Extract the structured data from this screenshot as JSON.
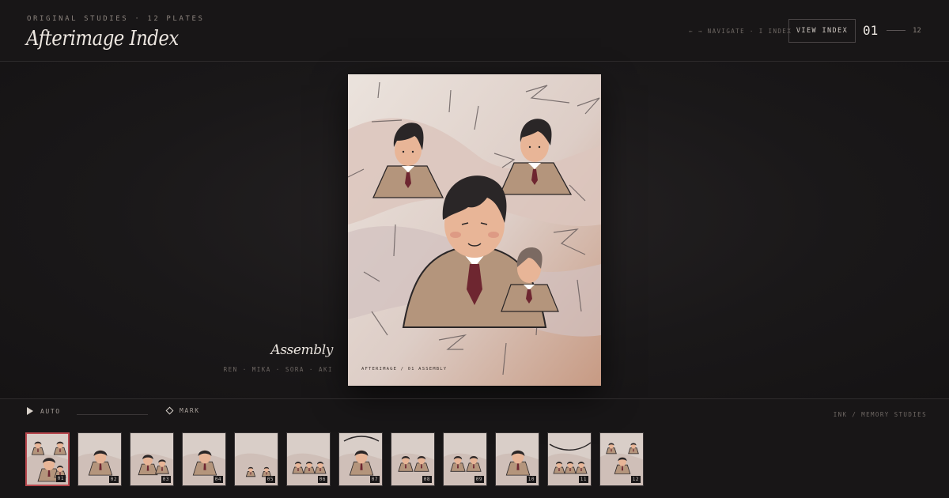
{
  "header": {
    "eyebrow": "ORIGINAL STUDIES · 12 PLATES",
    "title": "Afterimage Index",
    "nav_hint": "← → NAVIGATE · I INDEX",
    "view_index_label": "VIEW INDEX",
    "counter_current": "01",
    "counter_total": "12"
  },
  "plate": {
    "title": "Assembly",
    "names": "REN · MIKA · SORA · AKI",
    "label": "AFTERIMAGE / 01 ASSEMBLY",
    "icon": "portrait-illustration"
  },
  "controls": {
    "auto_label": "AUTO",
    "mark_label": "MARK",
    "footer_note": "INK / MEMORY STUDIES",
    "auto_icon": "play-icon",
    "mark_icon": "diamond-icon"
  },
  "thumbnails": [
    {
      "num": "01",
      "active": true
    },
    {
      "num": "02",
      "active": false
    },
    {
      "num": "03",
      "active": false
    },
    {
      "num": "04",
      "active": false
    },
    {
      "num": "05",
      "active": false
    },
    {
      "num": "06",
      "active": false
    },
    {
      "num": "07",
      "active": false
    },
    {
      "num": "08",
      "active": false
    },
    {
      "num": "09",
      "active": false
    },
    {
      "num": "10",
      "active": false
    },
    {
      "num": "11",
      "active": false
    },
    {
      "num": "12",
      "active": false
    }
  ],
  "colors": {
    "accent": "#b8474e",
    "background": "#181617",
    "coat": "#b4957c",
    "tie": "#6e2630",
    "hair": "#2a2627",
    "skin": "#e8b597"
  }
}
